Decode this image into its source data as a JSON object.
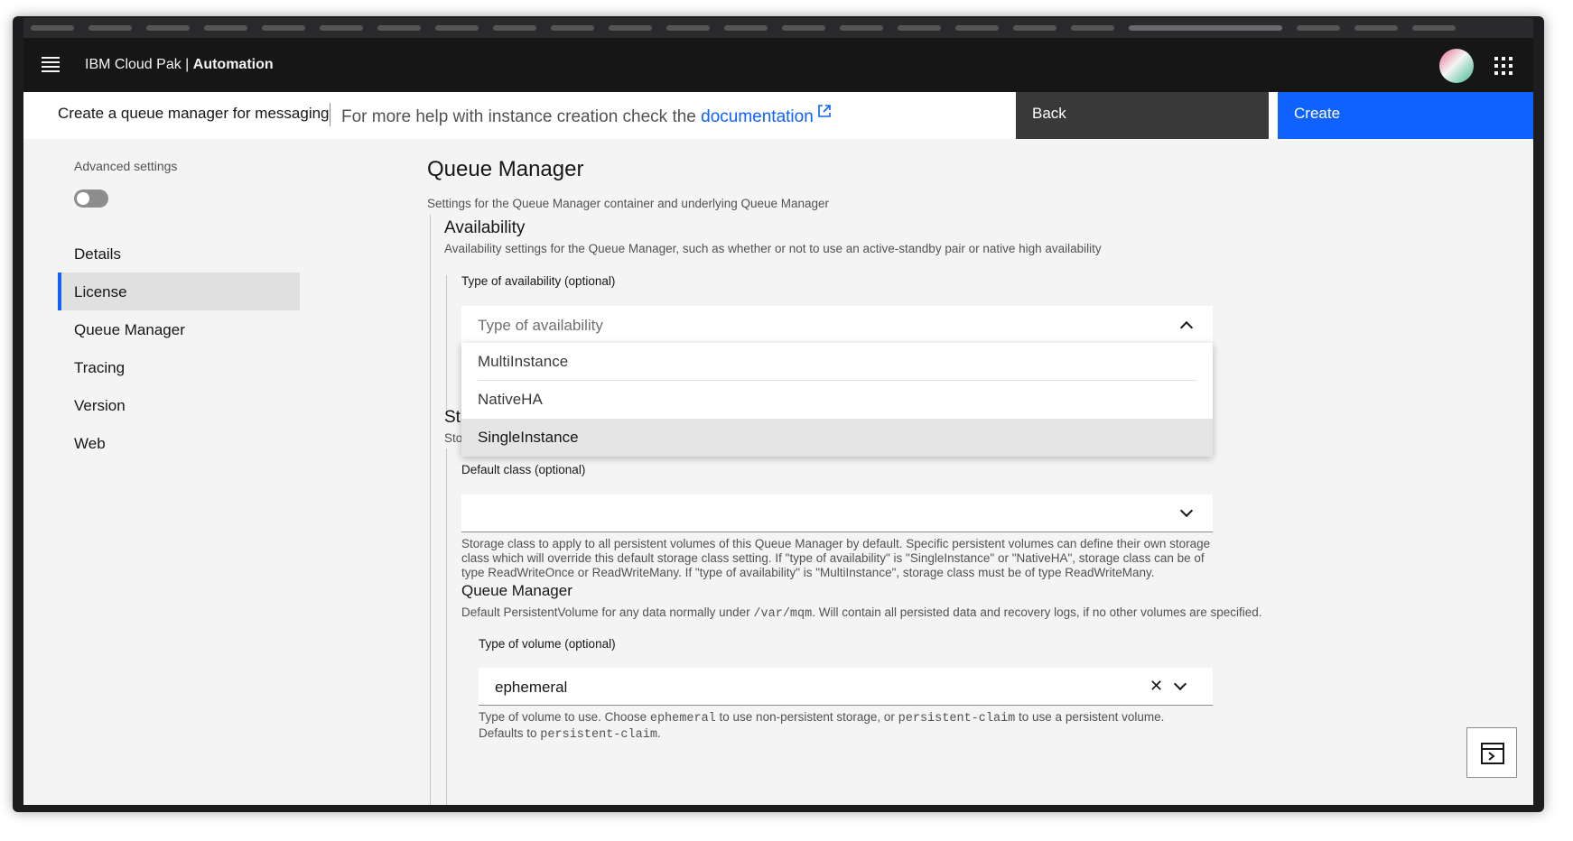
{
  "header": {
    "brand_prefix": "IBM Cloud Pak | ",
    "brand_bold": "Automation",
    "menu_icon": "hamburger-icon",
    "avatar_icon": "avatar",
    "apps_icon": "app-switcher-icon"
  },
  "action_bar": {
    "title": "Create a queue manager for messaging",
    "help_prefix": "For more help with instance creation check the ",
    "help_link": "documentation",
    "back_label": "Back",
    "create_label": "Create"
  },
  "sidebar": {
    "advanced_label": "Advanced settings",
    "advanced_enabled": false,
    "items": [
      {
        "label": "Details"
      },
      {
        "label": "License"
      },
      {
        "label": "Queue Manager"
      },
      {
        "label": "Tracing"
      },
      {
        "label": "Version"
      },
      {
        "label": "Web"
      }
    ],
    "selected": "License"
  },
  "main": {
    "title": "Queue Manager",
    "subtitle": "Settings for the Queue Manager container and underlying Queue Manager",
    "availability": {
      "title": "Availability",
      "description": "Availability settings for the Queue Manager, such as whether or not to use an active-standby pair or native high availability",
      "type_label": "Type of availability (optional)",
      "type_placeholder": "Type of availability",
      "options": [
        "MultiInstance",
        "NativeHA",
        "SingleInstance"
      ],
      "highlighted": "SingleInstance"
    },
    "storage": {
      "title_partial": "St",
      "desc_partial": "Sto",
      "default_class_label": "Default class (optional)",
      "default_class_value": "",
      "default_class_help": "Storage class to apply to all persistent volumes of this Queue Manager by default. Specific persistent volumes can define their own storage class which will override this default storage class setting. If \"type of availability\" is \"SingleInstance\" or \"NativeHA\", storage class can be of type ReadWriteOnce or ReadWriteMany. If \"type of availability\" is \"MultiInstance\", storage class must be of type ReadWriteMany."
    },
    "qm_volume": {
      "title": "Queue Manager",
      "desc_prefix": "Default PersistentVolume for any data normally under ",
      "desc_code": "/var/mqm",
      "desc_suffix": ". Will contain all persisted data and recovery logs, if no other volumes are specified.",
      "type_label": "Type of volume (optional)",
      "type_value": "ephemeral",
      "help_1": "Type of volume to use. Choose ",
      "help_code_1": "ephemeral",
      "help_2": " to use non-persistent storage, or ",
      "help_code_2": "persistent-claim",
      "help_3": " to use a persistent volume. Defaults to ",
      "help_code_3": "persistent-claim",
      "help_4": "."
    }
  },
  "terminal_button_icon": "terminal-panel-icon"
}
